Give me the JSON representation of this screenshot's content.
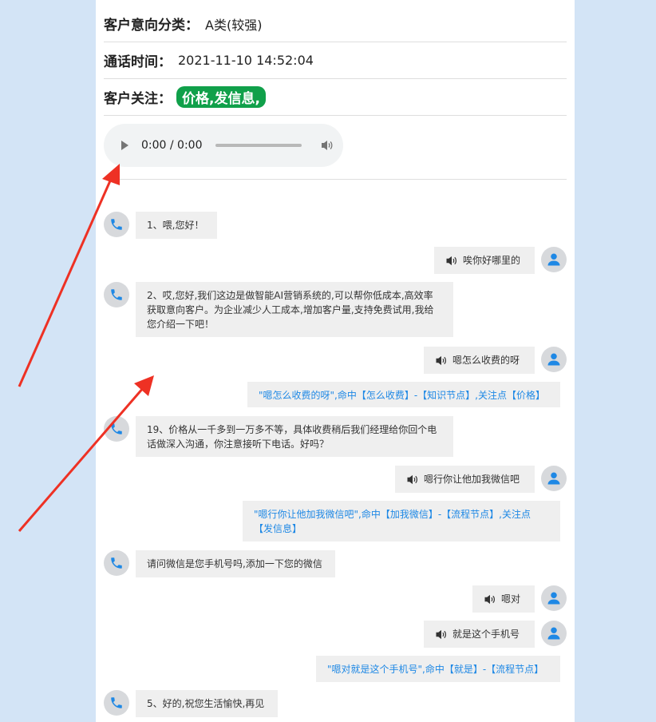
{
  "header": {
    "category_label": "客户意向分类：",
    "category_value": "A类(较强)",
    "call_time_label": "通话时间：",
    "call_time_value": "2021-11-10 14:52:04",
    "focus_label": "客户关注：",
    "focus_tag": "价格,发信息,"
  },
  "audio": {
    "time": "0:00 / 0:00"
  },
  "messages": {
    "m1": "1、喂,您好！",
    "m2": "唉你好哪里的",
    "m3": "2、哎,您好,我们这边是做智能AI营销系统的,可以帮你低成本,高效率获取意向客户。为企业减少人工成本,增加客户量,支持免费试用,我给您介绍一下吧！",
    "m4": "嗯怎么收费的呀",
    "m5": "\"嗯怎么收费的呀\",命中【怎么收费】-【知识节点】,关注点【价格】",
    "m6": "19、价格从一千多到一万多不等，具体收费稍后我们经理给你回个电话做深入沟通，你注意接听下电话。好吗？",
    "m7": "嗯行你让他加我微信吧",
    "m8": "\"嗯行你让他加我微信吧\",命中【加我微信】-【流程节点】,关注点【发信息】",
    "m9": "请问微信是您手机号吗,添加一下您的微信",
    "m10": "嗯对",
    "m11": "就是这个手机号",
    "m12": "\"嗯对就是这个手机号\",命中【就是】-【流程节点】",
    "m13": "5、好的,祝您生活愉快,再见"
  },
  "colors": {
    "background": "#d3e4f6",
    "tag": "#10a04a",
    "note_text": "#1e88e5",
    "arrow": "#ee3124"
  },
  "icons": {
    "bot": "phone-icon",
    "customer": "user-icon",
    "speaker": "speaker-icon"
  }
}
